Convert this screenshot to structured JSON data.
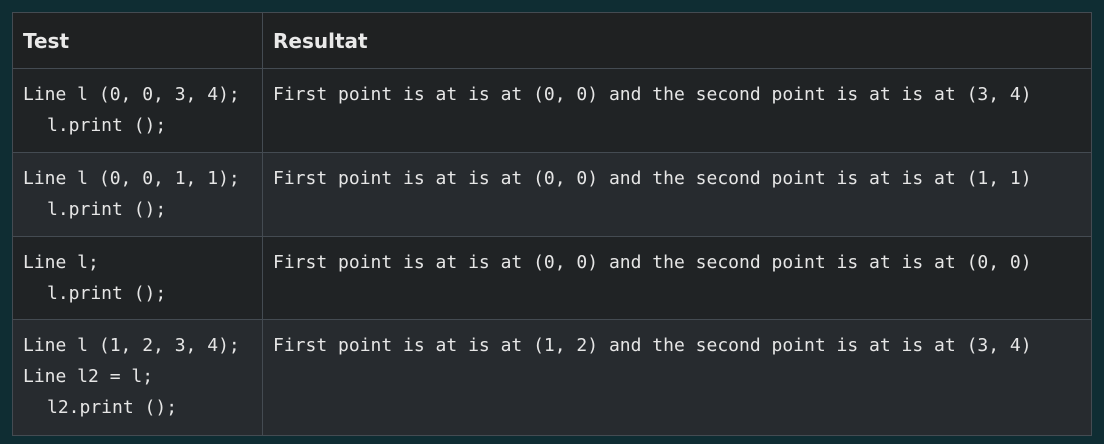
{
  "table": {
    "headers": [
      "Test",
      "Resultat"
    ],
    "rows": [
      {
        "test": [
          "Line l (0, 0, 3, 4);",
          "l.print ();"
        ],
        "result": "First point is at is at (0, 0) and the second point is at is at (3, 4)"
      },
      {
        "test": [
          "Line l (0, 0, 1, 1);",
          "l.print ();"
        ],
        "result": "First point is at is at (0, 0) and the second point is at is at (1, 1)"
      },
      {
        "test": [
          "Line l;",
          "l.print ();"
        ],
        "result": "First point is at is at (0, 0) and the second point is at is at (0, 0)"
      },
      {
        "test": [
          "Line l (1, 2, 3, 4);",
          "Line l2 = l;",
          "l2.print ();"
        ],
        "result": "First point is at is at (1, 2) and the second point is at is at (3, 4)"
      }
    ]
  },
  "colors": {
    "page_background": "#0f2d33",
    "header_background": "#1f2122",
    "row_odd": "#202325",
    "row_even": "#272b2f",
    "border": "#444b52",
    "text": "#e6e6e6"
  }
}
